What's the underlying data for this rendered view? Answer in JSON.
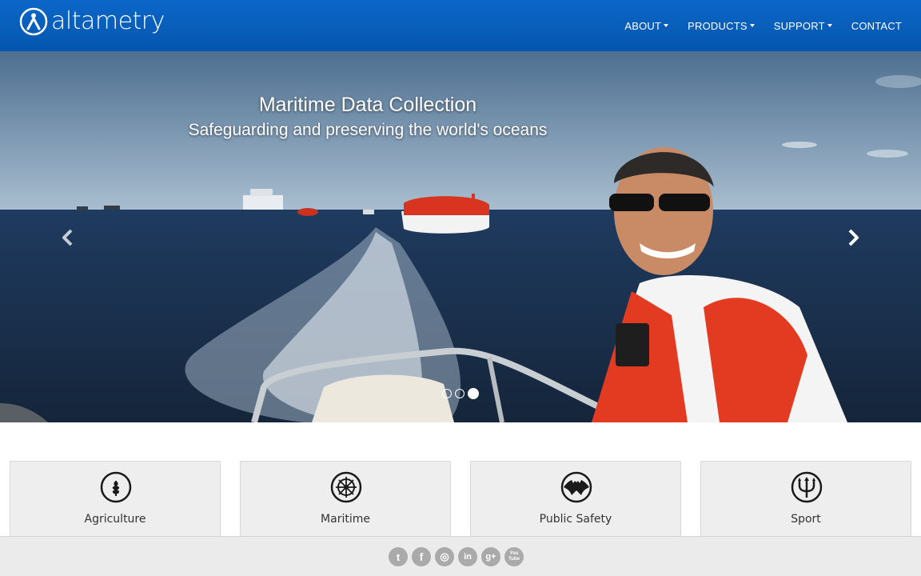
{
  "brand": {
    "name": "altametry",
    "logo_icon": "person-circle-logo"
  },
  "nav": {
    "items": [
      {
        "label": "ABOUT",
        "dropdown": true
      },
      {
        "label": "PRODUCTS",
        "dropdown": true
      },
      {
        "label": "SUPPORT",
        "dropdown": true
      },
      {
        "label": "CONTACT",
        "dropdown": false
      }
    ]
  },
  "hero": {
    "title": "Maritime Data Collection",
    "subtitle": "Safeguarding and preserving the world's oceans",
    "slide_count": 3,
    "active_slide": 3,
    "prev_icon": "chevron-left-icon",
    "next_icon": "chevron-right-icon"
  },
  "cards": [
    {
      "title": "Agriculture",
      "icon": "wheat-icon"
    },
    {
      "title": "Maritime",
      "icon": "ship-wheel-icon"
    },
    {
      "title": "Public Safety",
      "icon": "bat-emblem-icon"
    },
    {
      "title": "Sport",
      "icon": "trident-icon"
    }
  ],
  "footer": {
    "social": [
      {
        "name": "twitter-icon",
        "glyph": "t"
      },
      {
        "name": "facebook-icon",
        "glyph": "f"
      },
      {
        "name": "instagram-icon",
        "glyph": "◎"
      },
      {
        "name": "linkedin-icon",
        "glyph": "in"
      },
      {
        "name": "google-plus-icon",
        "glyph": "g+"
      },
      {
        "name": "youtube-icon",
        "glyph": "You Tube"
      }
    ]
  },
  "colors": {
    "navbar": "#0b67c8",
    "card_bg": "#eeeeee",
    "footer_bg": "#ebebeb",
    "social_icon": "#aaaaaa"
  }
}
